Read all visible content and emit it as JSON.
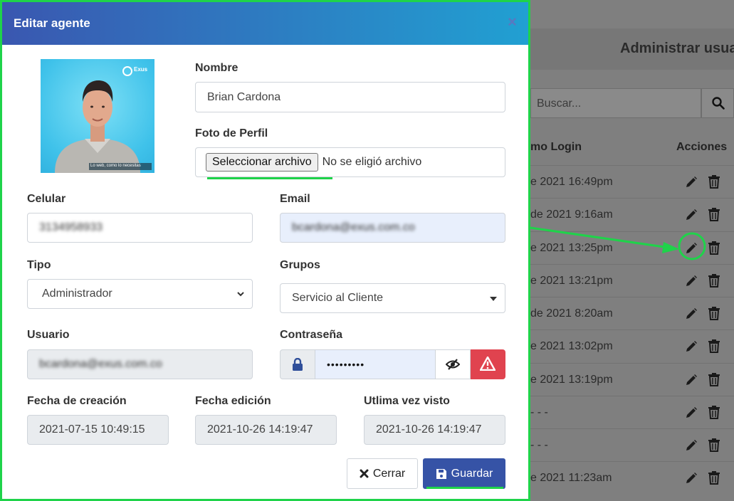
{
  "background": {
    "title": "Administrar usua",
    "search_placeholder": "Buscar...",
    "columns": {
      "login": "mo Login",
      "actions": "Acciones"
    },
    "rows": [
      "e 2021 16:49pm",
      "de 2021 9:16am",
      "e 2021 13:25pm",
      "e 2021 13:21pm",
      "de 2021 8:20am",
      "e 2021 13:02pm",
      "e 2021 13:19pm",
      "- - -",
      "- - -",
      "e 2021 11:23am"
    ]
  },
  "modal": {
    "title": "Editar agente",
    "close": "×",
    "nombre": {
      "label": "Nombre",
      "value": "Brian Cardona"
    },
    "foto": {
      "label": "Foto de Perfil",
      "button": "Seleccionar archivo",
      "status": "No se eligió archivo"
    },
    "celular": {
      "label": "Celular",
      "value": "3134958933"
    },
    "email": {
      "label": "Email",
      "value": "bcardona@exus.com.co"
    },
    "tipo": {
      "label": "Tipo",
      "value": "Administrador"
    },
    "grupos": {
      "label": "Grupos",
      "value": "Servicio al Cliente"
    },
    "usuario": {
      "label": "Usuario",
      "value": "bcardona@exus.com.co"
    },
    "contrasena": {
      "label": "Contraseña",
      "value": "•••••••••"
    },
    "fecha_creacion": {
      "label": "Fecha de creación",
      "value": "2021-07-15 10:49:15"
    },
    "fecha_edicion": {
      "label": "Fecha edición",
      "value": "2021-10-26 14:19:47"
    },
    "ultima_vez": {
      "label": "Utlima vez visto",
      "value": "2021-10-26 14:19:47"
    },
    "cancel_label": "Cerrar",
    "save_label": "Guardar",
    "avatar_caption": "Lo web, como lo necesitas",
    "avatar_brand": "Exus"
  },
  "colors": {
    "annotation": "#1fd34a",
    "save": "#3653a6",
    "danger": "#e0434f",
    "header_start": "#3a57b0",
    "header_end": "#21a0d2"
  }
}
